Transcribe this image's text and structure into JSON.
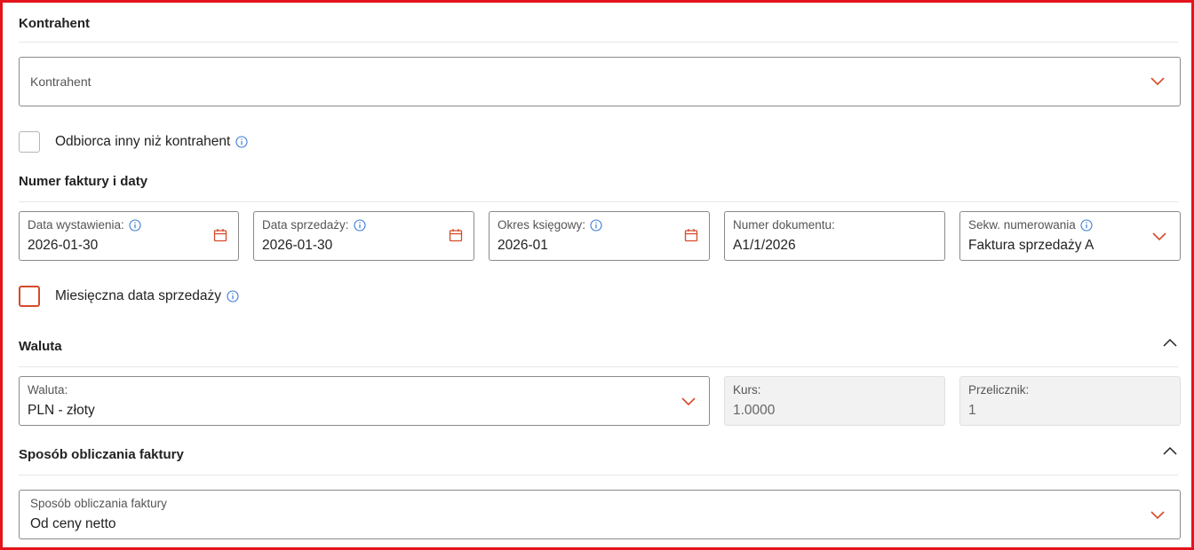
{
  "contractor_section": {
    "title": "Kontrahent",
    "select_placeholder": "Kontrahent",
    "other_recipient_label": "Odbiorca inny niż kontrahent"
  },
  "invoice_section": {
    "title": "Numer faktury i daty",
    "issue_date": {
      "label": "Data wystawienia:",
      "value": "2026-01-30"
    },
    "sale_date": {
      "label": "Data sprzedaży:",
      "value": "2026-01-30"
    },
    "accounting_period": {
      "label": "Okres księgowy:",
      "value": "2026-01"
    },
    "document_number": {
      "label": "Numer dokumentu:",
      "value": "A1/1/2026"
    },
    "numbering_sequence": {
      "label": "Sekw. numerowania",
      "value": "Faktura sprzedaży A"
    },
    "monthly_sale_date_label": "Miesięczna data sprzedaży"
  },
  "currency_section": {
    "title": "Waluta",
    "currency": {
      "label": "Waluta:",
      "value": "PLN - złoty"
    },
    "rate": {
      "label": "Kurs:",
      "value": "1.0000"
    },
    "converter": {
      "label": "Przelicznik:",
      "value": "1"
    }
  },
  "calculation_section": {
    "title": "Sposób obliczania faktury",
    "method": {
      "label": "Sposób obliczania faktury",
      "value": "Od ceny netto"
    }
  },
  "colors": {
    "accent": "#d64a2a",
    "info": "#3a7bd5",
    "frame": "#e3141b"
  }
}
